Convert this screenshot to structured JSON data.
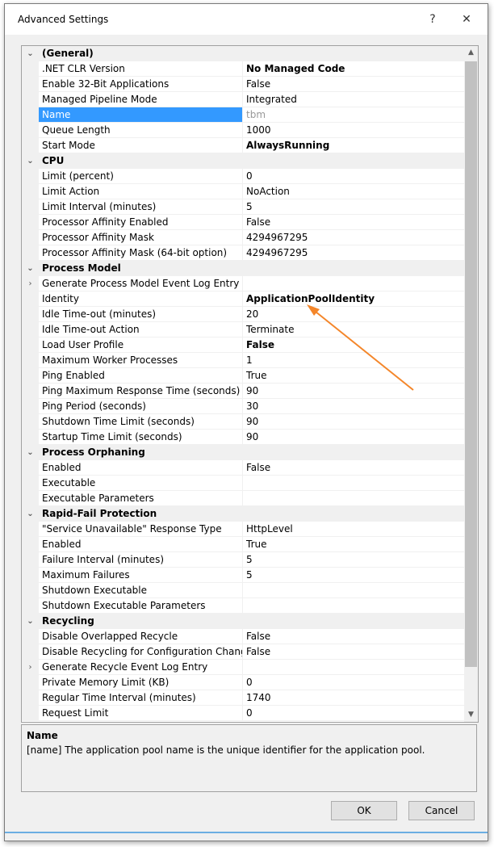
{
  "window": {
    "title": "Advanced Settings",
    "help_label": "?",
    "close_label": "✕"
  },
  "grid": {
    "scroll_up": "▲",
    "scroll_down": "▼",
    "rows": [
      {
        "type": "cat",
        "name": "(General)",
        "expander": "⌄"
      },
      {
        "type": "prop",
        "name": ".NET CLR Version",
        "value": "No Managed Code",
        "style": "bold"
      },
      {
        "type": "prop",
        "name": "Enable 32-Bit Applications",
        "value": "False"
      },
      {
        "type": "prop",
        "name": "Managed Pipeline Mode",
        "value": "Integrated"
      },
      {
        "type": "prop",
        "name": "Name",
        "value": "tbm",
        "style": "grey",
        "selected": true
      },
      {
        "type": "prop",
        "name": "Queue Length",
        "value": "1000"
      },
      {
        "type": "prop",
        "name": "Start Mode",
        "value": "AlwaysRunning",
        "style": "bold"
      },
      {
        "type": "cat",
        "name": "CPU",
        "expander": "⌄"
      },
      {
        "type": "prop",
        "name": "Limit (percent)",
        "value": "0"
      },
      {
        "type": "prop",
        "name": "Limit Action",
        "value": "NoAction"
      },
      {
        "type": "prop",
        "name": "Limit Interval (minutes)",
        "value": "5"
      },
      {
        "type": "prop",
        "name": "Processor Affinity Enabled",
        "value": "False"
      },
      {
        "type": "prop",
        "name": "Processor Affinity Mask",
        "value": "4294967295"
      },
      {
        "type": "prop",
        "name": "Processor Affinity Mask (64-bit option)",
        "value": "4294967295"
      },
      {
        "type": "cat",
        "name": "Process Model",
        "expander": "⌄"
      },
      {
        "type": "prop",
        "name": "Generate Process Model Event Log Entry",
        "value": "",
        "expander": "›"
      },
      {
        "type": "prop",
        "name": "Identity",
        "value": "ApplicationPoolIdentity",
        "style": "bold"
      },
      {
        "type": "prop",
        "name": "Idle Time-out (minutes)",
        "value": "20"
      },
      {
        "type": "prop",
        "name": "Idle Time-out Action",
        "value": "Terminate"
      },
      {
        "type": "prop",
        "name": "Load User Profile",
        "value": "False",
        "style": "bold"
      },
      {
        "type": "prop",
        "name": "Maximum Worker Processes",
        "value": "1"
      },
      {
        "type": "prop",
        "name": "Ping Enabled",
        "value": "True"
      },
      {
        "type": "prop",
        "name": "Ping Maximum Response Time (seconds)",
        "value": "90"
      },
      {
        "type": "prop",
        "name": "Ping Period (seconds)",
        "value": "30"
      },
      {
        "type": "prop",
        "name": "Shutdown Time Limit (seconds)",
        "value": "90"
      },
      {
        "type": "prop",
        "name": "Startup Time Limit (seconds)",
        "value": "90"
      },
      {
        "type": "cat",
        "name": "Process Orphaning",
        "expander": "⌄"
      },
      {
        "type": "prop",
        "name": "Enabled",
        "value": "False"
      },
      {
        "type": "prop",
        "name": "Executable",
        "value": ""
      },
      {
        "type": "prop",
        "name": "Executable Parameters",
        "value": ""
      },
      {
        "type": "cat",
        "name": "Rapid-Fail Protection",
        "expander": "⌄"
      },
      {
        "type": "prop",
        "name": "\"Service Unavailable\" Response Type",
        "value": "HttpLevel"
      },
      {
        "type": "prop",
        "name": "Enabled",
        "value": "True"
      },
      {
        "type": "prop",
        "name": "Failure Interval (minutes)",
        "value": "5"
      },
      {
        "type": "prop",
        "name": "Maximum Failures",
        "value": "5"
      },
      {
        "type": "prop",
        "name": "Shutdown Executable",
        "value": ""
      },
      {
        "type": "prop",
        "name": "Shutdown Executable Parameters",
        "value": ""
      },
      {
        "type": "cat",
        "name": "Recycling",
        "expander": "⌄"
      },
      {
        "type": "prop",
        "name": "Disable Overlapped Recycle",
        "value": "False"
      },
      {
        "type": "prop",
        "name": "Disable Recycling for Configuration Changes",
        "value": "False"
      },
      {
        "type": "prop",
        "name": "Generate Recycle Event Log Entry",
        "value": "",
        "expander": "›"
      },
      {
        "type": "prop",
        "name": "Private Memory Limit (KB)",
        "value": "0"
      },
      {
        "type": "prop",
        "name": "Regular Time Interval (minutes)",
        "value": "1740"
      },
      {
        "type": "prop",
        "name": "Request Limit",
        "value": "0"
      }
    ]
  },
  "description": {
    "title": "Name",
    "text": "[name] The application pool name is the unique identifier for the application pool."
  },
  "buttons": {
    "ok": "OK",
    "cancel": "Cancel"
  },
  "annotation": {
    "arrow_color": "#f4862a"
  }
}
